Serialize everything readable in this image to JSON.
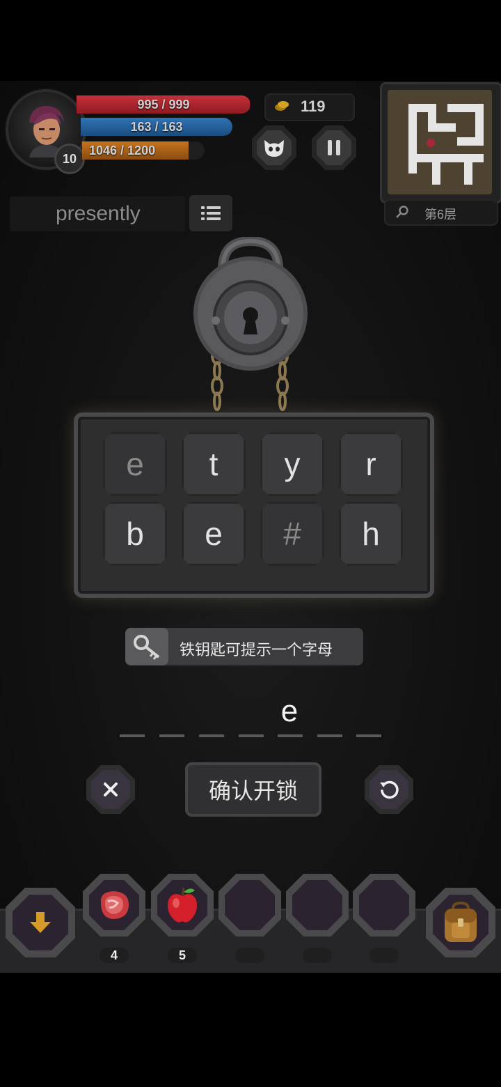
{
  "player": {
    "level": "10",
    "hp": "995 / 999",
    "hp_fraction": 0.996,
    "mp": "163 / 163",
    "mp_fraction": 1.0,
    "xp": "1046 / 1200",
    "xp_fraction": 0.872
  },
  "currency": {
    "gold": "119",
    "icon": "gold-coin-icon"
  },
  "buttons": {
    "pet_icon": "pet-face-icon",
    "pause_icon": "pause-icon"
  },
  "minimap": {
    "floor_label": "第6层",
    "search_icon": "search-icon"
  },
  "word_panel": {
    "word": "presently",
    "list_icon": "list-icon"
  },
  "lock": {
    "letters": [
      "e",
      "t",
      "y",
      "r",
      "b",
      "e",
      "#",
      "h"
    ],
    "hint": "铁钥匙可提示一个字母",
    "typed_letter": "e",
    "confirm_label": "确认开锁",
    "clear_icon": "close-icon",
    "reset_icon": "undo-icon"
  },
  "inventory": {
    "down_icon": "arrow-down-icon",
    "slots": [
      {
        "item": "meat-icon",
        "count": "4"
      },
      {
        "item": "apple-icon",
        "count": "5"
      },
      {
        "item": "",
        "count": ""
      },
      {
        "item": "",
        "count": ""
      },
      {
        "item": "",
        "count": ""
      }
    ],
    "bag_icon": "backpack-icon"
  }
}
